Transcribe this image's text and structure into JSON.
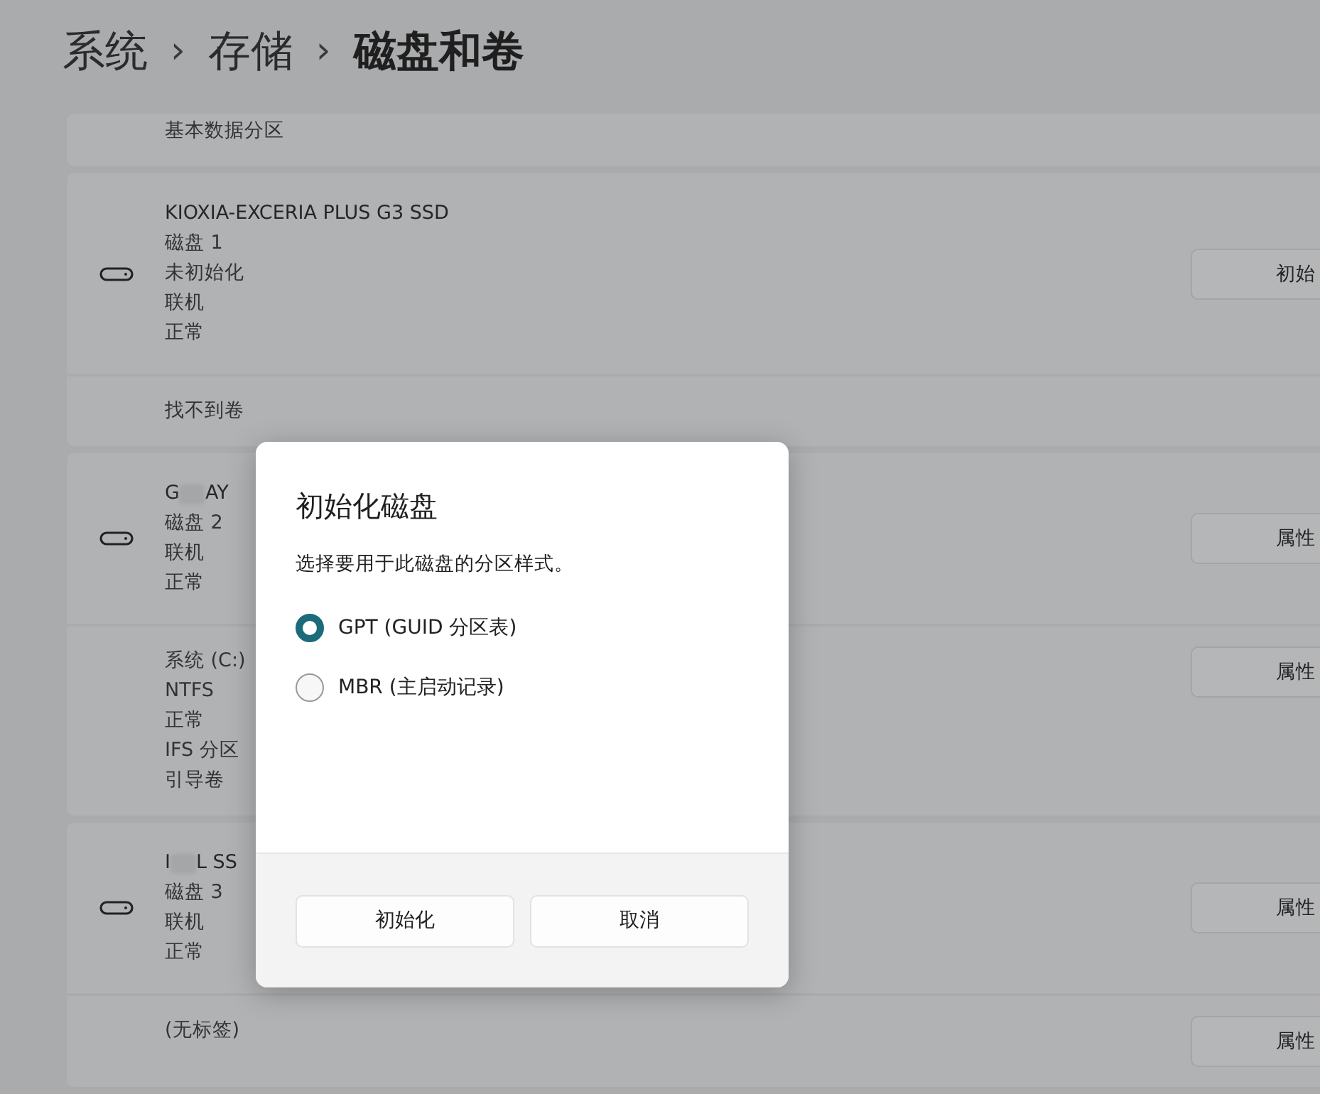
{
  "breadcrumb": [
    {
      "kind": "crumb",
      "text": "系统"
    },
    {
      "kind": "separator",
      "text": "›"
    },
    {
      "kind": "crumb",
      "text": "存储"
    },
    {
      "kind": "separator",
      "text": "›"
    },
    {
      "kind": "current",
      "text": "磁盘和卷"
    }
  ],
  "cards": [
    {
      "rows": [
        {
          "kind": "volume",
          "lines": [
            "基本数据分区"
          ]
        }
      ]
    },
    {
      "rows": [
        {
          "kind": "disk",
          "name_start": "KIOXIA-EXCERIA PLUS G3 SSD",
          "lines": [
            "磁盘 1",
            "未初始化",
            "联机",
            "正常"
          ],
          "button": "初始"
        },
        {
          "kind": "note",
          "lines": [
            "找不到卷"
          ]
        }
      ]
    },
    {
      "rows": [
        {
          "kind": "disk",
          "name_start": "G",
          "name_end": "AY",
          "lines": [
            "磁盘 2",
            "联机",
            "正常"
          ],
          "button": "属性"
        },
        {
          "kind": "volume",
          "lines": [
            "系统 (C:)",
            "NTFS",
            "正常",
            "IFS 分区",
            "引导卷"
          ],
          "button": "属性"
        }
      ]
    },
    {
      "rows": [
        {
          "kind": "disk",
          "name_start": "I",
          "name_end": "L SS",
          "lines": [
            "磁盘 3",
            "联机",
            "正常"
          ],
          "button": "属性"
        },
        {
          "kind": "volume",
          "lines": [
            "(无标签)"
          ],
          "button": "属性"
        }
      ]
    }
  ],
  "dialog": {
    "title": "初始化磁盘",
    "description": "选择要用于此磁盘的分区样式。",
    "options": [
      {
        "label": "GPT (GUID 分区表)",
        "selected": true
      },
      {
        "label": "MBR (主启动记录)",
        "selected": false
      }
    ],
    "buttons": [
      "初始化",
      "取消"
    ]
  }
}
